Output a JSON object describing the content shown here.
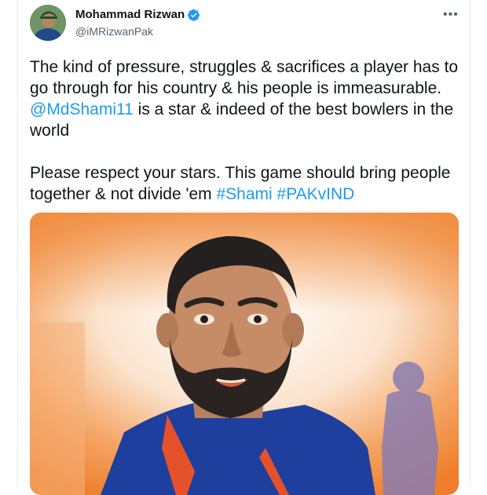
{
  "author": {
    "display_name": "Mohammad Rizwan",
    "handle": "@iMRizwanPak",
    "avatar_icon": "profile-avatar",
    "verified_icon": "verified-badge-icon"
  },
  "more_label": "•••",
  "tweet": {
    "p1_a": "The kind of pressure, struggles & sacrifices a player has to go through for his country & his people is immeasurable. ",
    "p1_mention": "@MdShami11",
    "p1_b": " is a star & indeed of the best bowlers in the world",
    "p2_a": "Please respect your stars. This game should bring people together & not divide 'em ",
    "p2_tag1": "#Shami",
    "p2_tag2": "#PAKvIND"
  },
  "colors": {
    "link": "#1d9bf0",
    "verified": "#1d9bf0",
    "text": "#0f1419",
    "secondary": "#536471",
    "jersey": "#1f3f9e",
    "background_orange": "#f08a3c"
  },
  "media": {
    "type": "illustration",
    "description_icon": "portrait-illustration"
  }
}
